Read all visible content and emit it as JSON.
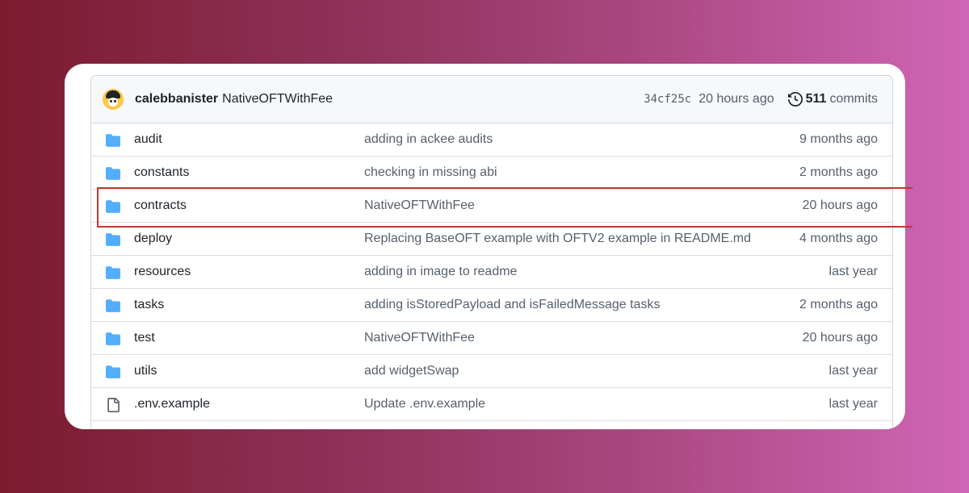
{
  "commit": {
    "author": "calebbanister",
    "message": "NativeOFTWithFee",
    "sha": "34cf25c",
    "time": "20 hours ago",
    "commit_count": "511",
    "commits_label": "commits"
  },
  "files": [
    {
      "name": "audit",
      "type": "folder",
      "message": "adding in ackee audits",
      "age": "9 months ago"
    },
    {
      "name": "constants",
      "type": "folder",
      "message": "checking in missing abi",
      "age": "2 months ago"
    },
    {
      "name": "contracts",
      "type": "folder",
      "message": "NativeOFTWithFee",
      "age": "20 hours ago"
    },
    {
      "name": "deploy",
      "type": "folder",
      "message": "Replacing BaseOFT example with OFTV2 example in README.md",
      "age": "4 months ago"
    },
    {
      "name": "resources",
      "type": "folder",
      "message": "adding in image to readme",
      "age": "last year"
    },
    {
      "name": "tasks",
      "type": "folder",
      "message": "adding isStoredPayload and isFailedMessage tasks",
      "age": "2 months ago"
    },
    {
      "name": "test",
      "type": "folder",
      "message": "NativeOFTWithFee",
      "age": "20 hours ago"
    },
    {
      "name": "utils",
      "type": "folder",
      "message": "add widgetSwap",
      "age": "last year"
    },
    {
      "name": ".env.example",
      "type": "file",
      "message": "Update .env.example",
      "age": "last year"
    }
  ],
  "colors": {
    "folder": "#54aeff",
    "highlight": "#c0392b"
  }
}
